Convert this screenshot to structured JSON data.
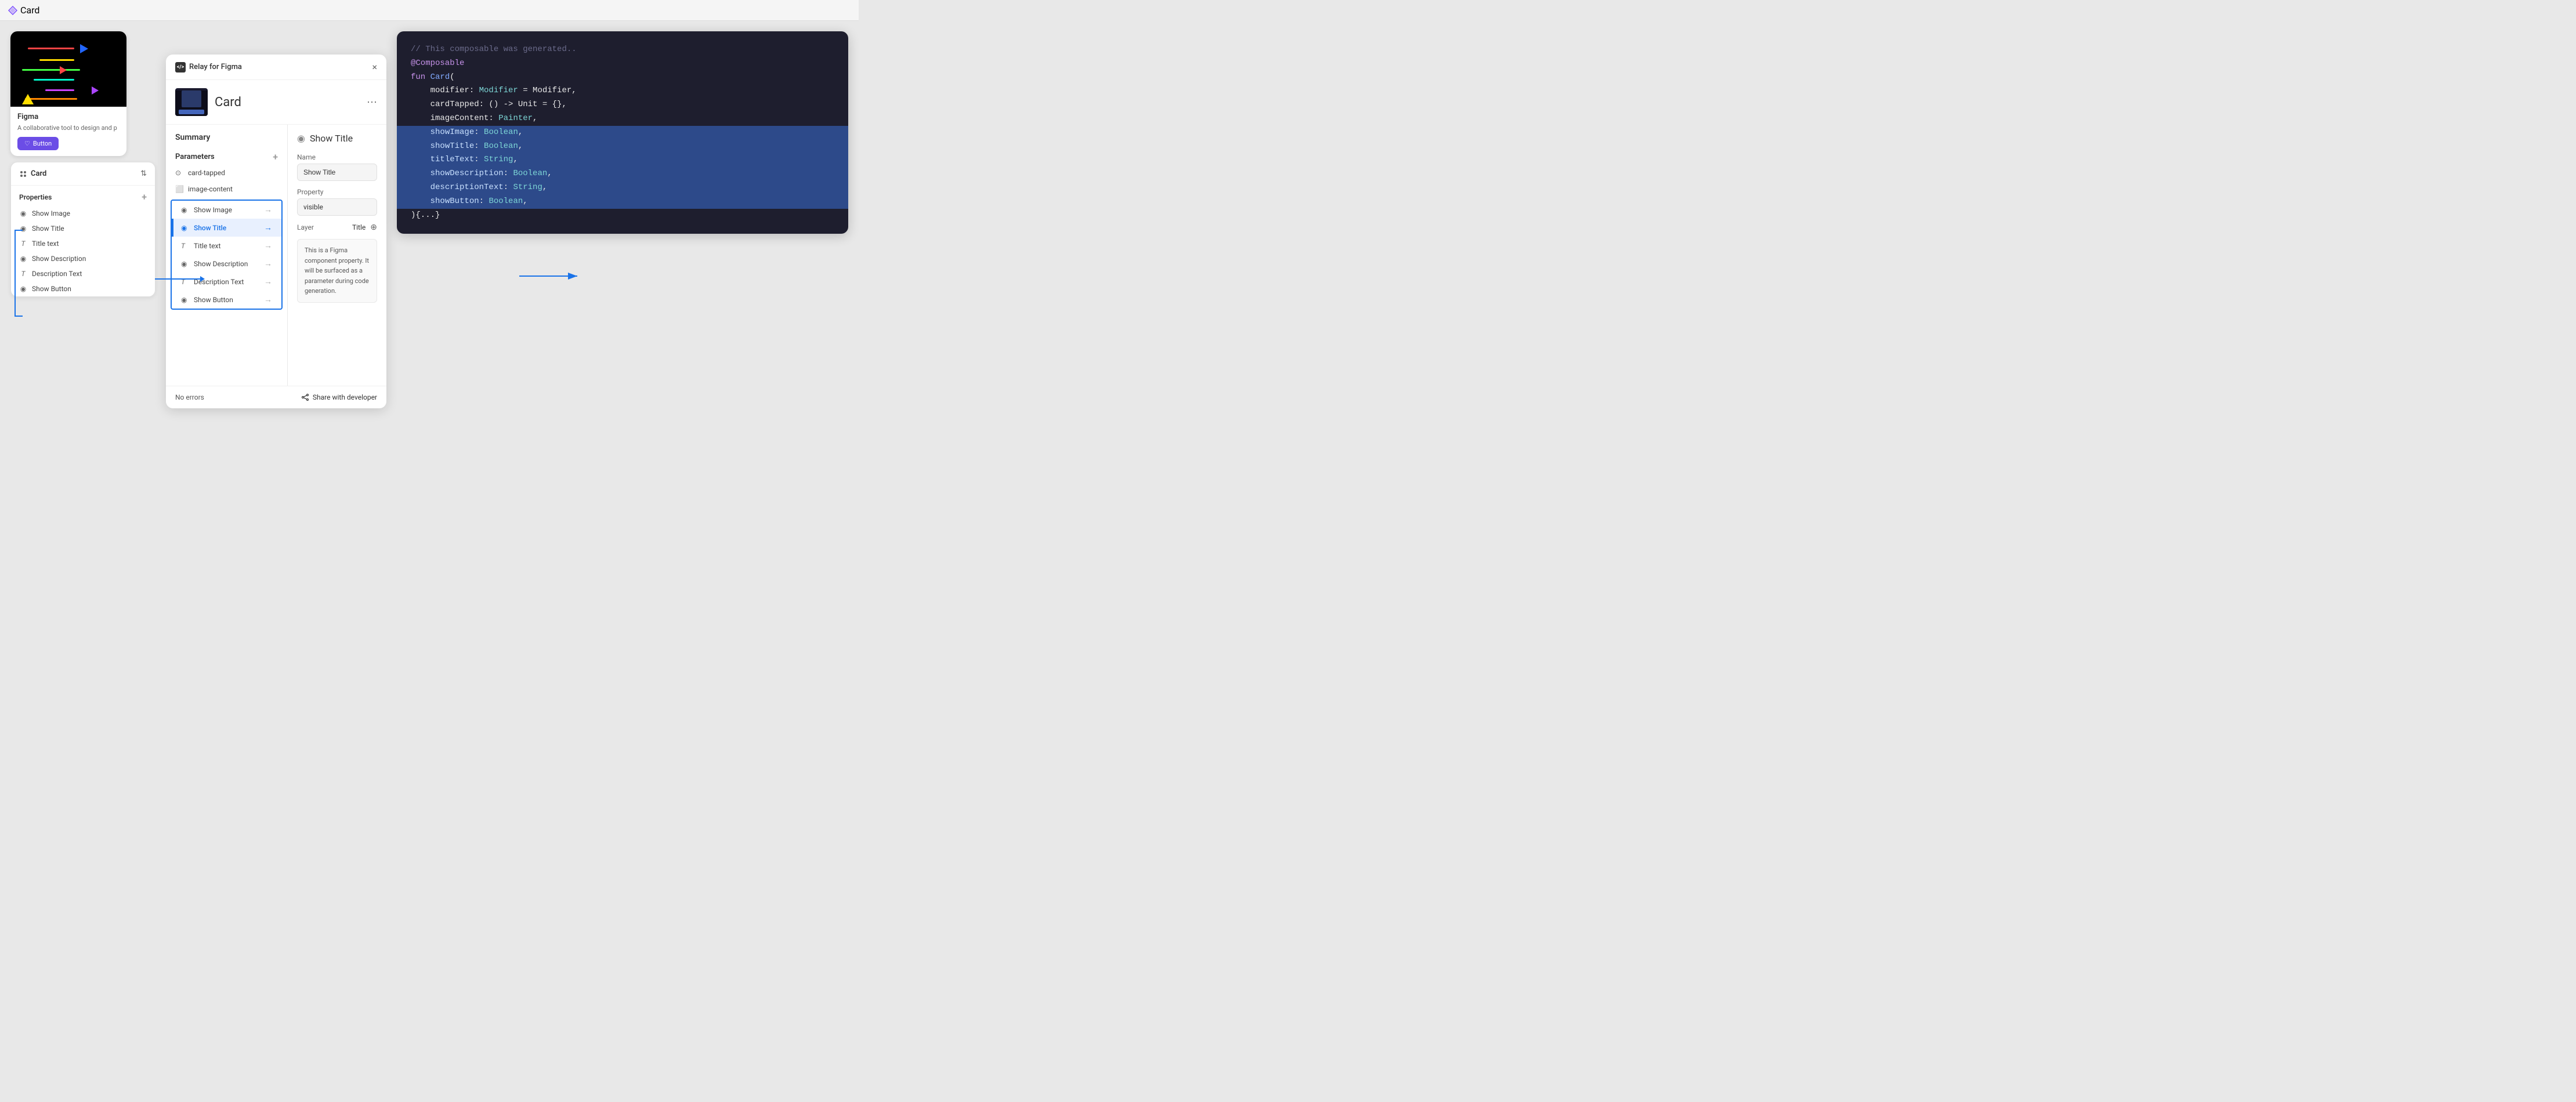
{
  "app": {
    "title": "Card",
    "icon": "diamond"
  },
  "topbar": {
    "title": "Card"
  },
  "figma_preview": {
    "card_name": "Figma",
    "card_desc": "A collaborative tool to design and p",
    "button_text": "Button"
  },
  "properties_panel": {
    "title": "Card",
    "section_label": "Properties",
    "items": [
      {
        "icon": "eye",
        "label": "Show Image"
      },
      {
        "icon": "eye",
        "label": "Show Title"
      },
      {
        "icon": "T",
        "label": "Title text"
      },
      {
        "icon": "eye",
        "label": "Show Description"
      },
      {
        "icon": "T",
        "label": "Description Text"
      },
      {
        "icon": "eye",
        "label": "Show Button"
      }
    ]
  },
  "relay_panel": {
    "header_title": "Relay for Figma",
    "close_label": "×",
    "card_name": "Card",
    "more_label": "⋯",
    "left_col": {
      "summary_label": "Summary",
      "parameters_label": "Parameters",
      "add_icon": "+",
      "items": [
        {
          "icon": "tap",
          "label": "card-tapped",
          "type": "param"
        },
        {
          "icon": "image",
          "label": "image-content",
          "type": "param"
        },
        {
          "icon": "eye",
          "label": "Show Image",
          "type": "visibility"
        },
        {
          "icon": "eye",
          "label": "Show Title",
          "type": "visibility",
          "active": true
        },
        {
          "icon": "T",
          "label": "Title text",
          "type": "text"
        },
        {
          "icon": "eye",
          "label": "Show Description",
          "type": "visibility"
        },
        {
          "icon": "T",
          "label": "Description Text",
          "type": "text"
        },
        {
          "icon": "eye",
          "label": "Show Button",
          "type": "visibility"
        }
      ]
    },
    "right_col": {
      "title": "Show Title",
      "eye_icon": "👁",
      "name_label": "Name",
      "name_value": "Show Title",
      "property_label": "Property",
      "property_value": "visible",
      "layer_label": "Layer",
      "layer_value": "Title",
      "description": "This is a Figma component property. It will be surfaced as a parameter during code generation."
    },
    "footer": {
      "no_errors": "No errors",
      "share_label": "Share with developer"
    }
  },
  "code_panel": {
    "comment": "// This composable was generated..",
    "lines": [
      {
        "type": "decorator",
        "text": "@Composable"
      },
      {
        "type": "function",
        "keyword": "fun",
        "name": "Card(",
        "normal": ""
      },
      {
        "type": "param",
        "text": "    modifier: Modifier = Modifier,"
      },
      {
        "type": "param",
        "text": "    cardTapped: () -> Unit = {},"
      },
      {
        "type": "param",
        "text": "    imageContent: Painter,"
      },
      {
        "type": "param_highlight",
        "text": "    showImage: Boolean,"
      },
      {
        "type": "param_highlight",
        "text": "    showTitle: Boolean,"
      },
      {
        "type": "param_highlight",
        "text": "    titleText: String,"
      },
      {
        "type": "param_highlight",
        "text": "    showDescription: Boolean,"
      },
      {
        "type": "param_highlight",
        "text": "    descriptionText: String,"
      },
      {
        "type": "param_highlight",
        "text": "    showButton: Boolean,"
      },
      {
        "type": "closing",
        "text": "){...}"
      }
    ]
  },
  "arrows": {
    "properties_to_relay": true,
    "relay_to_code": true
  }
}
